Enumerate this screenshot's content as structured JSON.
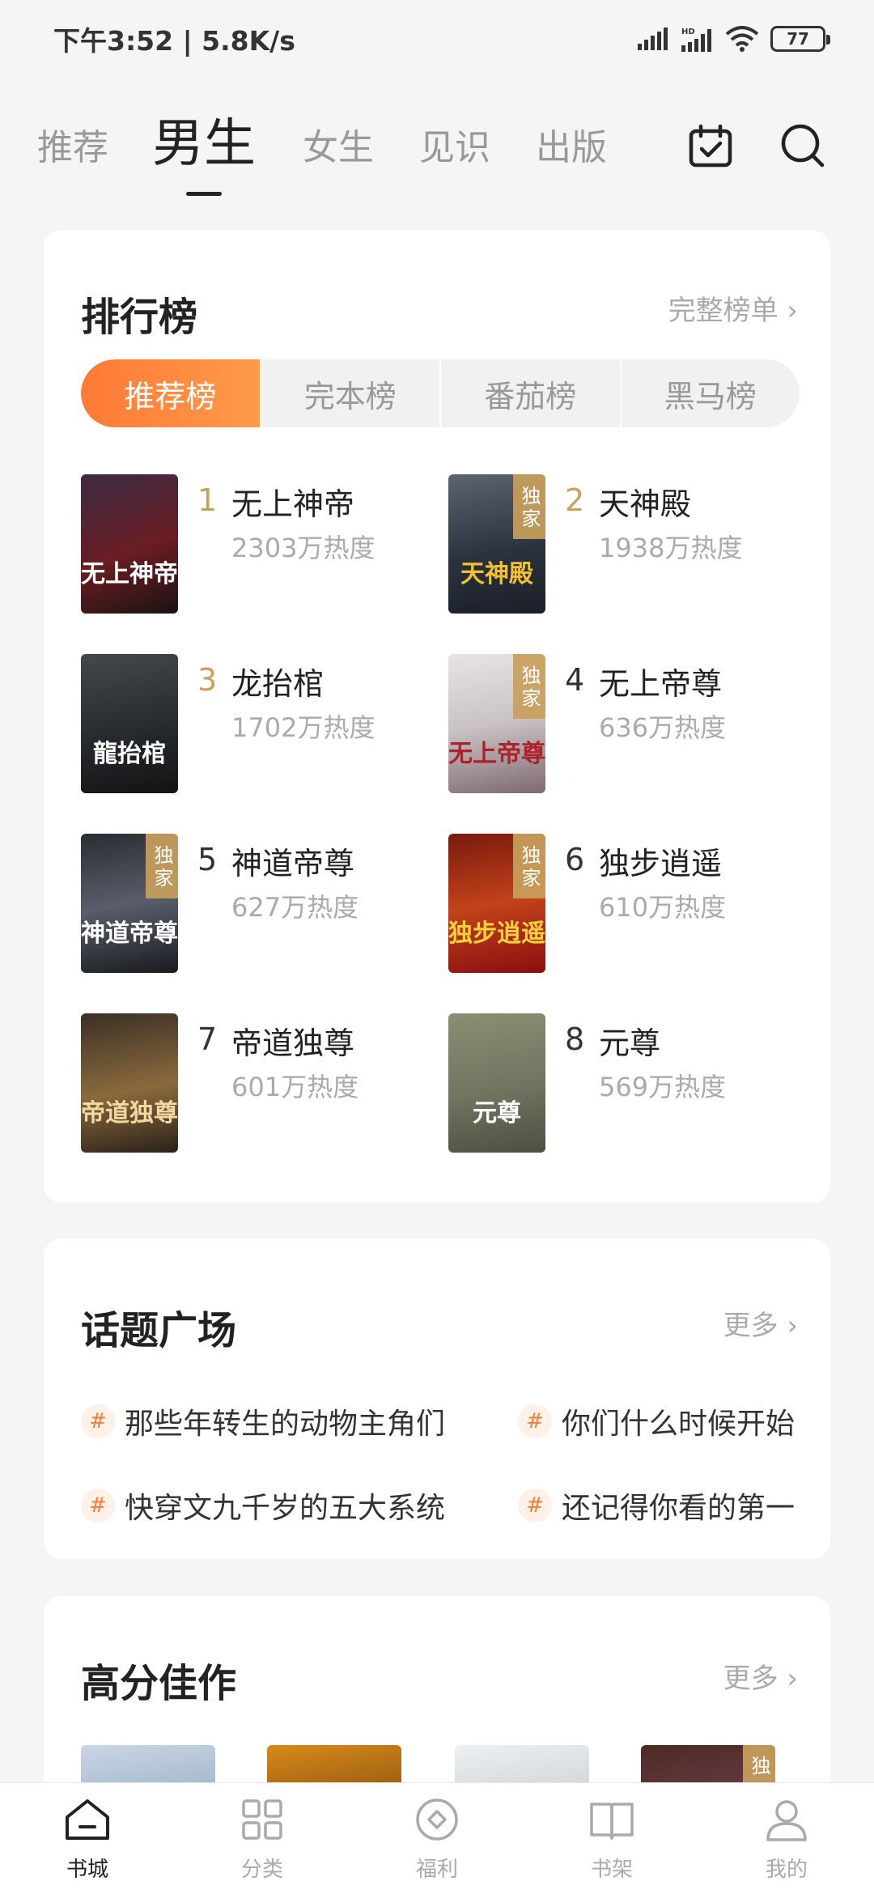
{
  "status_bar": {
    "time": "下午3:52 | 5.8K/s",
    "battery": "77"
  },
  "top_nav": {
    "tabs": [
      {
        "label": "推荐",
        "active": false
      },
      {
        "label": "男生",
        "active": true
      },
      {
        "label": "女生",
        "active": false
      },
      {
        "label": "见识",
        "active": false
      },
      {
        "label": "出版",
        "active": false
      }
    ],
    "icons": [
      "calendar-check-icon",
      "search-icon"
    ]
  },
  "ranking": {
    "title": "排行榜",
    "more": "完整榜单 ›",
    "segments": [
      "推荐榜",
      "完本榜",
      "番茄榜",
      "黑马榜"
    ],
    "books": [
      {
        "rank": "1",
        "title": "无上神帝",
        "heat": "2303万热度",
        "exclusive": false,
        "cover_text": "无上神帝"
      },
      {
        "rank": "2",
        "title": "天神殿",
        "heat": "1938万热度",
        "exclusive": true,
        "cover_text": "天神殿"
      },
      {
        "rank": "3",
        "title": "龙抬棺",
        "heat": "1702万热度",
        "exclusive": false,
        "cover_text": "龍抬棺"
      },
      {
        "rank": "4",
        "title": "无上帝尊",
        "heat": "636万热度",
        "exclusive": true,
        "cover_text": "无上帝尊"
      },
      {
        "rank": "5",
        "title": "神道帝尊",
        "heat": "627万热度",
        "exclusive": true,
        "cover_text": "神道帝尊"
      },
      {
        "rank": "6",
        "title": "独步逍遥",
        "heat": "610万热度",
        "exclusive": true,
        "cover_text": "独步逍遥"
      },
      {
        "rank": "7",
        "title": "帝道独尊",
        "heat": "601万热度",
        "exclusive": false,
        "cover_text": "帝道独尊"
      },
      {
        "rank": "8",
        "title": "元尊",
        "heat": "569万热度",
        "exclusive": false,
        "cover_text": "元尊"
      }
    ],
    "exclusive_label": "独家"
  },
  "topics": {
    "title": "话题广场",
    "more": "更多 ›",
    "items": [
      {
        "text": "那些年转生的动物主角们"
      },
      {
        "text": "你们什么时候开始"
      },
      {
        "text": "快穿文九千岁的五大系统"
      },
      {
        "text": "还记得你看的第一"
      }
    ]
  },
  "high_score": {
    "title": "高分佳作",
    "more": "更多 ›",
    "exclusive_label": "独"
  },
  "bottom_bar": [
    {
      "label": "书城",
      "icon": "bookstore-icon",
      "active": true
    },
    {
      "label": "分类",
      "icon": "category-grid-icon",
      "active": false
    },
    {
      "label": "福利",
      "icon": "coin-icon",
      "active": false
    },
    {
      "label": "书架",
      "icon": "bookshelf-icon",
      "active": false
    },
    {
      "label": "我的",
      "icon": "profile-icon",
      "active": false
    }
  ]
}
